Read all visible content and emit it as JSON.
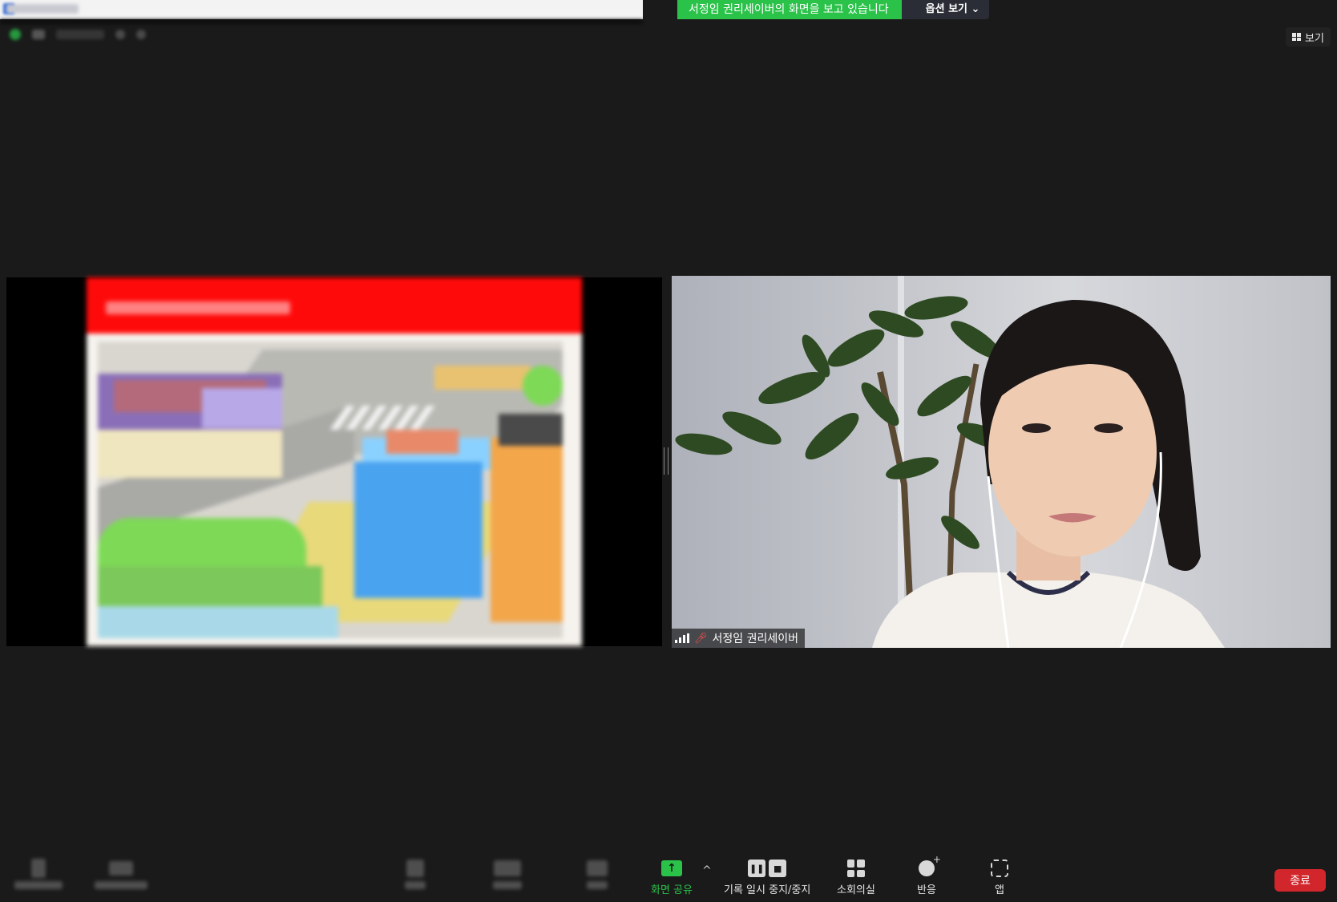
{
  "banner": {
    "message": "서정임 권리세이버의 화면을 보고 있습니다",
    "options_label": "옵션 보기",
    "options_chevron": "⌄"
  },
  "view": {
    "label": "보기",
    "icon": "grid-icon"
  },
  "participant": {
    "name": "서정임 권리세이버",
    "mic_icon": "mic-muted-icon",
    "signal_icon": "signal-bars-icon"
  },
  "toolbar": {
    "share_label": "화면 공유",
    "share_icon_glyph": "↑",
    "caret": "^",
    "record_label": "기록 일시 중지/중지",
    "record_pause_glyph": "❚❚",
    "record_stop_glyph": "■",
    "breakout_label": "소회의실",
    "reactions_label": "반응",
    "apps_label": "앱",
    "end_label": "종료"
  },
  "colors": {
    "accent_green": "#2bc24a",
    "end_red": "#d1262b",
    "background": "#1a1a1a",
    "slide_header_red": "#ff0a0a"
  }
}
